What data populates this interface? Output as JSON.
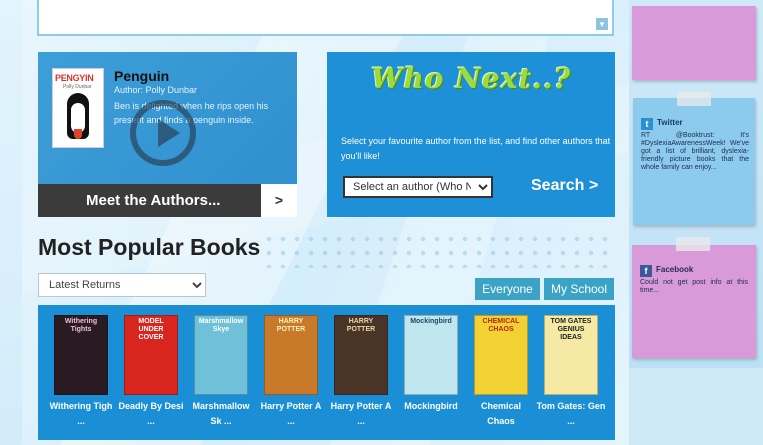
{
  "top_widget": {
    "scroll_arrow": "▾"
  },
  "authors_panel": {
    "book_cover_title": "PENGYIN",
    "book_cover_sub": "Polly Dunbar",
    "title": "Penguin",
    "author_line": "Author: Polly Dunbar",
    "description": "Ben is delighted when he rips open his present and finds a penguin inside.",
    "meet_label": "Meet the Authors...",
    "meet_arrow": ">"
  },
  "who_next": {
    "logo": "Who Next..?",
    "text": "Select your favourite author from the list, and find other authors that you'll like!",
    "select_value": "Select an author (Who Next)",
    "search_label": "Search >"
  },
  "popular": {
    "title": "Most Popular Books",
    "filter_value": "Latest Returns",
    "tabs": [
      "Everyone",
      "My School"
    ],
    "books": [
      {
        "title": "Withering Tigh ...",
        "cover_text": "Withering Tights",
        "color": "#2a1a22",
        "text_color": "#f0c0d0"
      },
      {
        "title": "Deadly By Desi ...",
        "cover_text": "MODEL UNDER COVER",
        "color": "#d8261f",
        "text_color": "#ffffff"
      },
      {
        "title": "Marshmallow Sk ...",
        "cover_text": "Marshmallow Skye",
        "color": "#6ec1d9",
        "text_color": "#ffffff"
      },
      {
        "title": "Harry Potter A ...",
        "cover_text": "HARRY POTTER",
        "color": "#c87a2a",
        "text_color": "#fff2c0"
      },
      {
        "title": "Harry Potter A ...",
        "cover_text": "HARRY POTTER",
        "color": "#4a3428",
        "text_color": "#e9d7a0"
      },
      {
        "title": "Mockingbird",
        "cover_text": "Mockingbird",
        "color": "#bfe6ef",
        "text_color": "#1b4a62"
      },
      {
        "title": "Chemical Chaos",
        "cover_text": "CHEMICAL CHAOS",
        "color": "#f2d233",
        "text_color": "#b3261e"
      },
      {
        "title": "Tom Gates: Gen ...",
        "cover_text": "TOM GATES GENIUS IDEAS",
        "color": "#f5e9a4",
        "text_color": "#222222"
      }
    ]
  },
  "twitter": {
    "icon": "t",
    "heading": "Twitter",
    "body": "RT @Booktrust: It's #DyslexiaAwarenessWeek! We've got a list of brilliant, dyslexia-friendly picture books that the whole family can enjoy..."
  },
  "facebook": {
    "icon": "f",
    "heading": "Facebook",
    "body": "Could not get post info at this time..."
  }
}
